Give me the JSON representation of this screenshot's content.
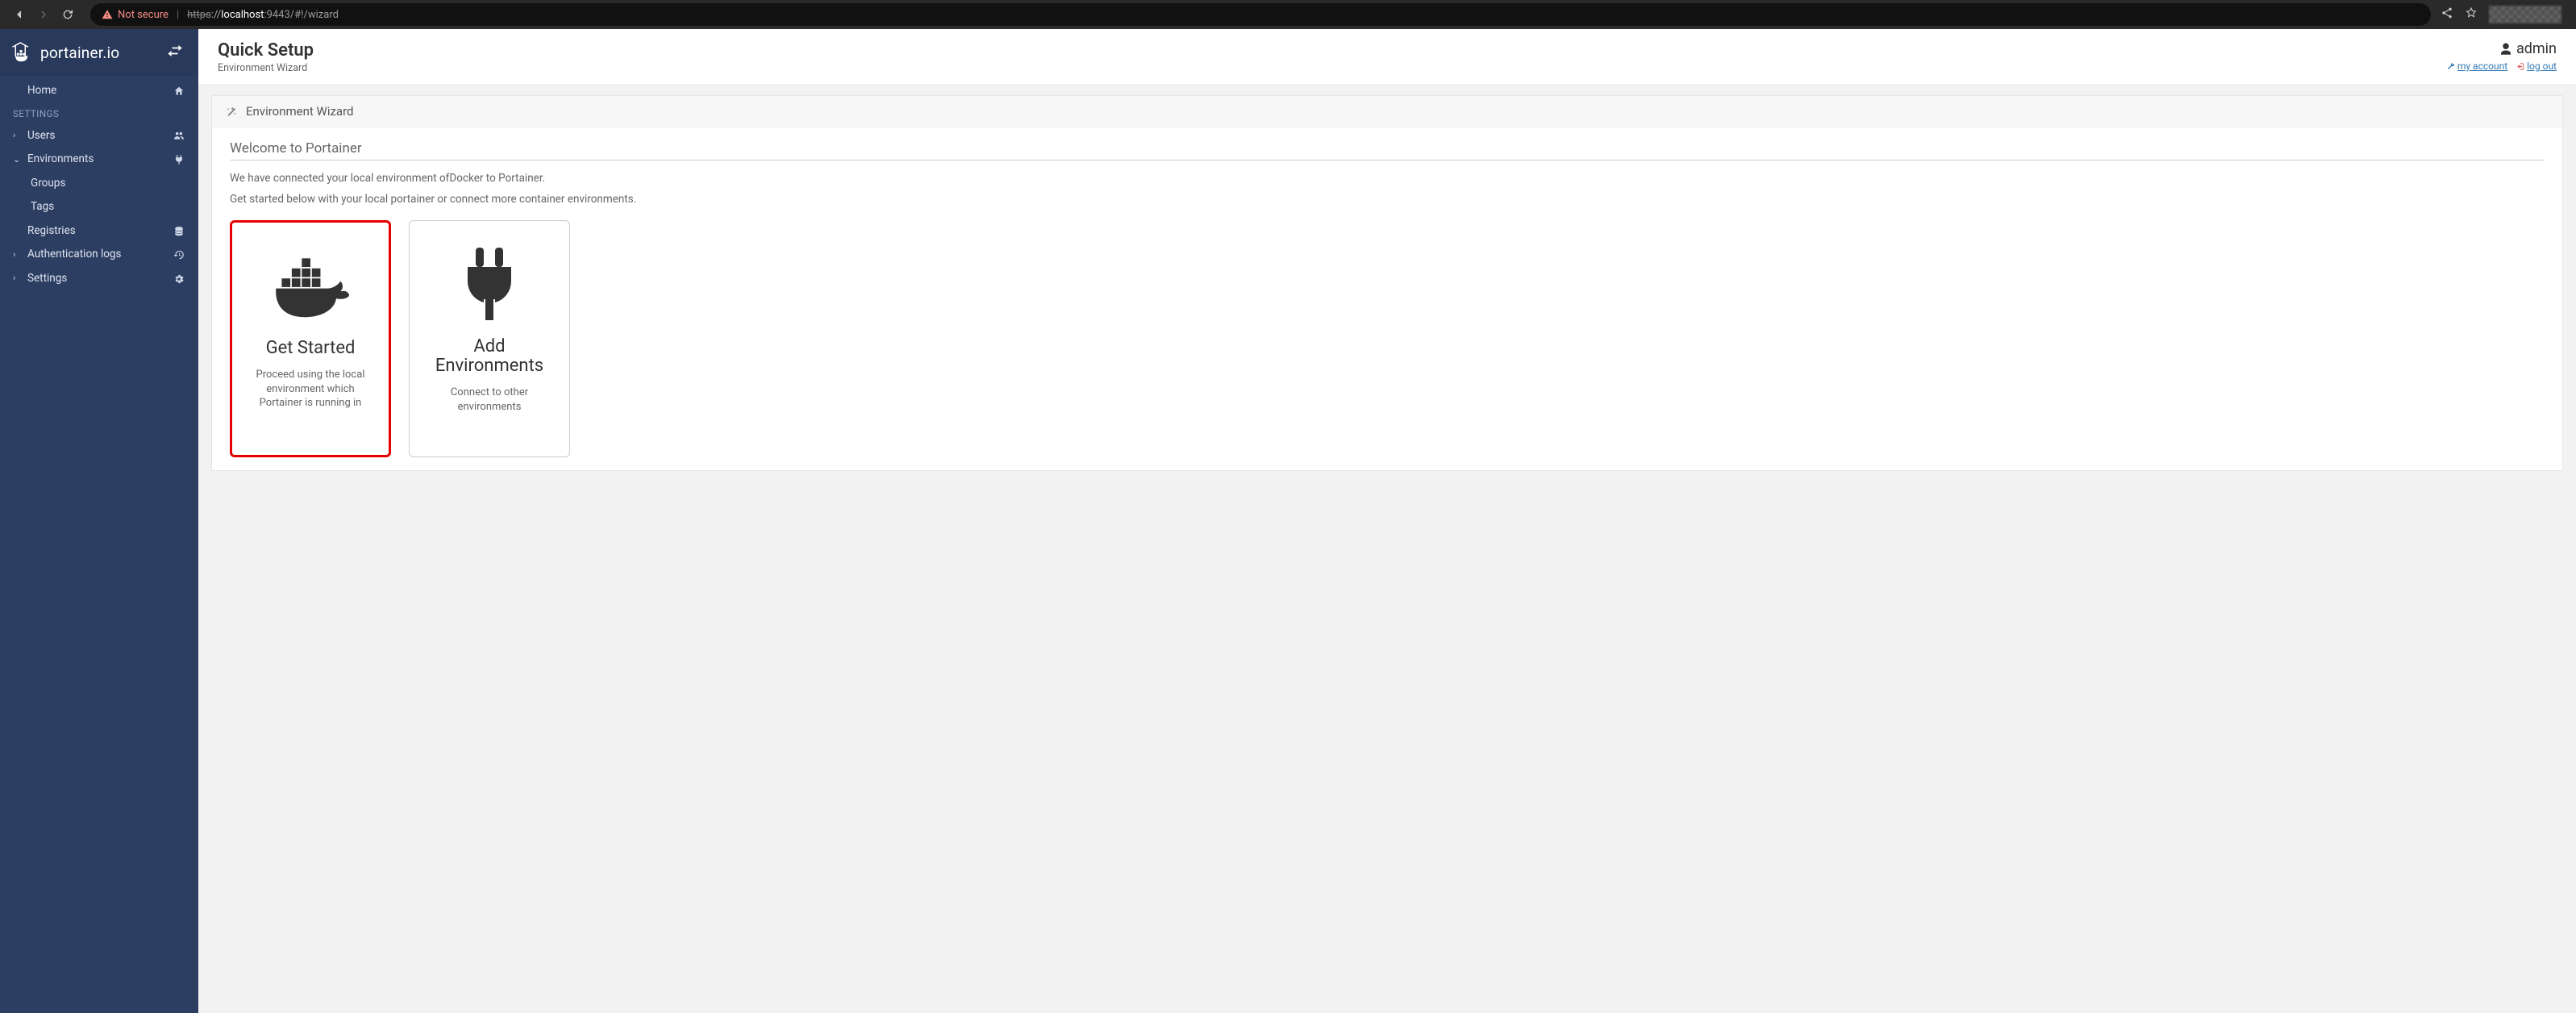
{
  "browser": {
    "not_secure": "Not secure",
    "url_scheme": "https",
    "url_sep": "://",
    "url_host": "localhost",
    "url_rest": ":9443/#!/wizard"
  },
  "sidebar": {
    "brand": "portainer.io",
    "items": {
      "home": "Home",
      "settings_header": "SETTINGS",
      "users": "Users",
      "environments": "Environments",
      "groups": "Groups",
      "tags": "Tags",
      "registries": "Registries",
      "auth_logs": "Authentication logs",
      "settings": "Settings"
    }
  },
  "header": {
    "title": "Quick Setup",
    "subtitle": "Environment Wizard",
    "username": "admin",
    "my_account": "my account",
    "log_out": "log out"
  },
  "panel": {
    "title": "Environment Wizard",
    "welcome": "Welcome to Portainer",
    "desc1": "We have connected your local environment ofDocker to Portainer.",
    "desc2": "Get started below with your local portainer or connect more container environments."
  },
  "cards": {
    "get_started": {
      "title": "Get Started",
      "sub": "Proceed using the local environment which Portainer is running in"
    },
    "add_env": {
      "title": "Add Environments",
      "sub": "Connect to other environments"
    }
  }
}
